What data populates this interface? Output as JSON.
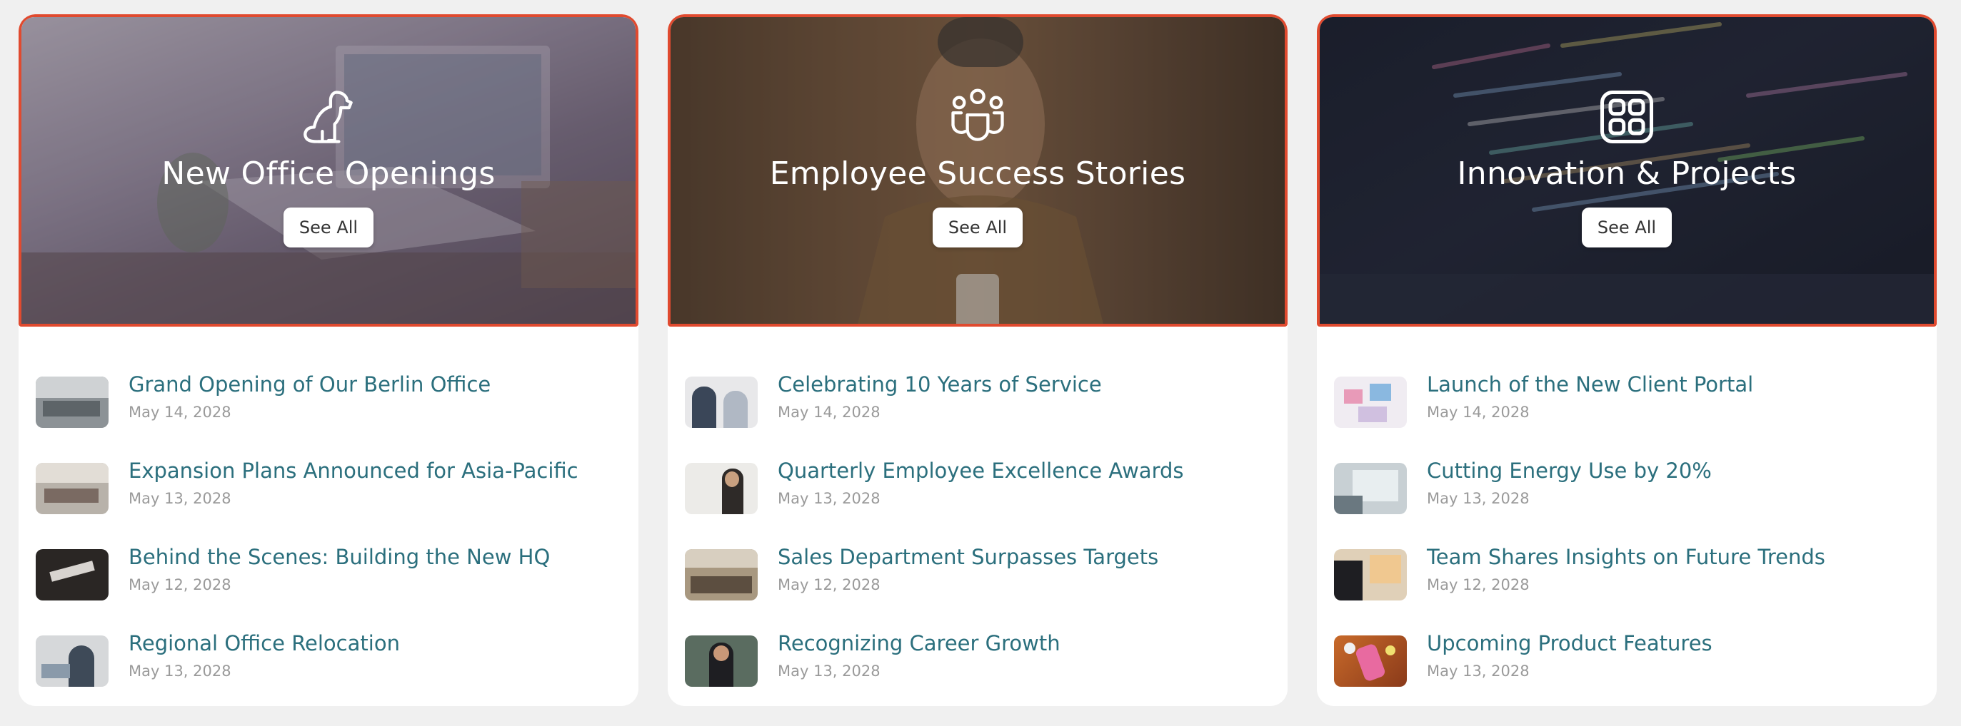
{
  "cards": [
    {
      "title": "New Office Openings",
      "icon": "dog-icon",
      "see_all": "See All",
      "items": [
        {
          "title": "Grand Opening of Our Berlin Office",
          "date": "May 14, 2028"
        },
        {
          "title": "Expansion Plans Announced for Asia-Pacific",
          "date": "May 13, 2028"
        },
        {
          "title": "Behind the Scenes: Building the New HQ",
          "date": "May 12, 2028"
        },
        {
          "title": "Regional Office Relocation",
          "date": "May 13, 2028"
        }
      ]
    },
    {
      "title": "Employee Success Stories",
      "icon": "people-group-icon",
      "see_all": "See All",
      "items": [
        {
          "title": "Celebrating 10 Years of Service",
          "date": "May 14, 2028"
        },
        {
          "title": "Quarterly Employee Excellence Awards",
          "date": "May 13, 2028"
        },
        {
          "title": "Sales Department Surpasses Targets",
          "date": "May 12, 2028"
        },
        {
          "title": "Recognizing Career Growth",
          "date": "May 13, 2028"
        }
      ]
    },
    {
      "title": "Innovation & Projects",
      "icon": "grid-apps-icon",
      "see_all": "See All",
      "items": [
        {
          "title": "Launch of the New Client Portal",
          "date": "May 14, 2028"
        },
        {
          "title": "Cutting Energy Use by 20%",
          "date": "May 13, 2028"
        },
        {
          "title": "Team Shares Insights on Future Trends",
          "date": "May 12, 2028"
        },
        {
          "title": "Upcoming Product Features",
          "date": "May 13, 2028"
        }
      ]
    }
  ],
  "colors": {
    "accent_border": "#e04a2f",
    "link_title": "#2b6f7d",
    "date": "#9a9a9a",
    "page_bg": "#f0f0f0"
  }
}
